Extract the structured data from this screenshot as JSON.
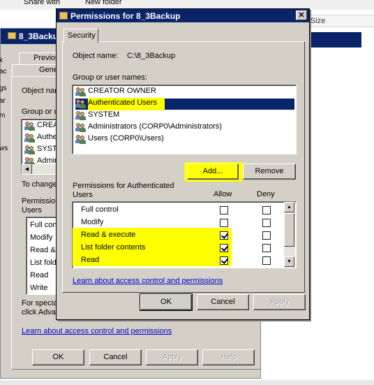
{
  "background_toolbar": {
    "share_with": "Share with",
    "new_folder": "New folder",
    "size_header": "Size"
  },
  "left_fragments": [
    "k",
    "ac",
    "gs",
    "ar",
    "m",
    "ws"
  ],
  "back_dialog": {
    "title": "8_3Backup",
    "tabs": [
      "Previou",
      "Gene"
    ],
    "object_name_label": "Object nar",
    "group_label": "Group or u",
    "users": [
      "CREA",
      "Authe",
      "SYST",
      "Admin"
    ],
    "to_change": "To change",
    "permissions_label_1": "Permission",
    "permissions_label_2": "Users",
    "permissions": [
      "Full con",
      "Modify",
      "Read &",
      "List fold",
      "Read",
      "Write"
    ],
    "special_1": "For specia",
    "special_2": "click Adva",
    "link": "Learn about access control and permissions",
    "buttons": {
      "ok": "OK",
      "cancel": "Cancel",
      "apply": "Apply",
      "help": "Help"
    }
  },
  "front_dialog": {
    "title": "Permissions for 8_3Backup",
    "close_glyph": "✕",
    "tab": "Security",
    "object_name_label": "Object name:",
    "object_name_value": "C:\\8_3Backup",
    "group_label": "Group or user names:",
    "users": [
      {
        "name": "CREATOR OWNER"
      },
      {
        "name": "Authenticated Users",
        "selected": true
      },
      {
        "name": "SYSTEM"
      },
      {
        "name": "Administrators (CORP0\\Administrators)"
      },
      {
        "name": "Users (CORP0\\Users)"
      }
    ],
    "add_button": "Add...",
    "remove_button": "Remove",
    "permissions_for_1": "Permissions for Authenticated",
    "permissions_for_2": "Users",
    "allow_header": "Allow",
    "deny_header": "Deny",
    "permissions": [
      {
        "name": "Full control",
        "allow": false,
        "deny": false
      },
      {
        "name": "Modify",
        "allow": false,
        "deny": false
      },
      {
        "name": "Read & execute",
        "allow": true,
        "deny": false
      },
      {
        "name": "List folder contents",
        "allow": true,
        "deny": false
      },
      {
        "name": "Read",
        "allow": true,
        "deny": false
      }
    ],
    "link": "Learn about access control and permissions",
    "buttons": {
      "ok": "OK",
      "cancel": "Cancel",
      "apply": "Apply"
    }
  },
  "colors": {
    "highlight": "#ffff00",
    "title_bar": "#0a246a",
    "selection": "#0a246a",
    "link": "#0000cc"
  }
}
